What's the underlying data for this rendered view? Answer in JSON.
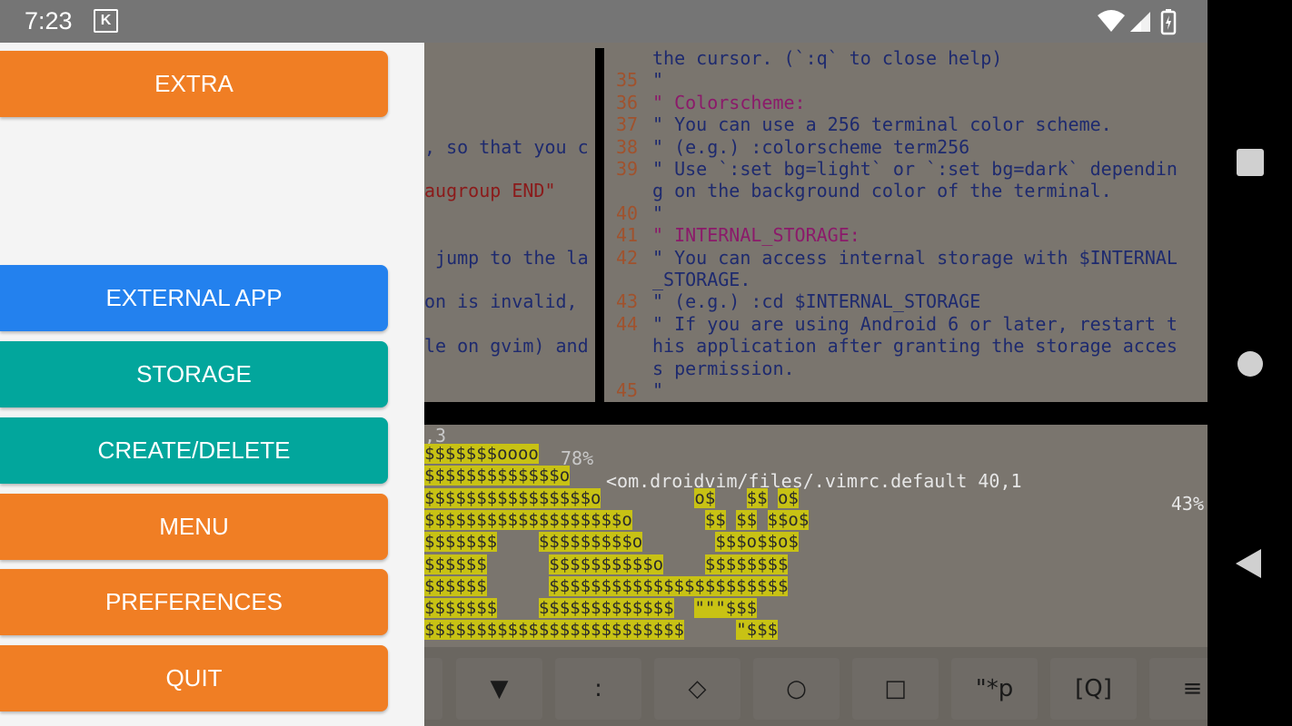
{
  "status_bar": {
    "time": "7:23",
    "app_icon_letter": "K",
    "icons": [
      "wifi-icon",
      "signal-icon",
      "battery-icon"
    ]
  },
  "drawer": {
    "buttons": [
      {
        "label": "EXTRA",
        "color": "#f07e24"
      },
      {
        "label": "EXTERNAL APP",
        "color": "#2381ee"
      },
      {
        "label": "STORAGE",
        "color": "#02a69c"
      },
      {
        "label": "CREATE/DELETE",
        "color": "#02a69c"
      },
      {
        "label": "MENU",
        "color": "#f07e24"
      },
      {
        "label": "PREFERENCES",
        "color": "#f07e24"
      },
      {
        "label": "QUIT",
        "color": "#f07e24"
      }
    ]
  },
  "vim": {
    "left_pane": [
      "",
      "",
      "",
      "",
      ", so that you c",
      "",
      "augroup END\"",
      "",
      "",
      " jump to the la",
      "",
      "on is invalid, ",
      "",
      "le on gvim) and",
      ""
    ],
    "right_pane": [
      {
        "num": "",
        "text": "the cursor. (`:q` to close help)"
      },
      {
        "num": "35",
        "text": "\""
      },
      {
        "num": "36",
        "text": "\" Colorscheme:"
      },
      {
        "num": "37",
        "text": "\" You can use a 256 terminal color scheme."
      },
      {
        "num": "38",
        "text": "\" (e.g.) :colorscheme term256"
      },
      {
        "num": "39",
        "text": "\" Use `:set bg=light` or `:set bg=dark` dependin"
      },
      {
        "num": "",
        "text": "g on the background color of the terminal."
      },
      {
        "num": "40",
        "text": "\""
      },
      {
        "num": "41",
        "text": "\" INTERNAL_STORAGE:"
      },
      {
        "num": "42",
        "text": "\" You can access internal storage with $INTERNAL"
      },
      {
        "num": "",
        "text": "_STORAGE."
      },
      {
        "num": "43",
        "text": "\" (e.g.) :cd $INTERNAL_STORAGE"
      },
      {
        "num": "44",
        "text": "\" If you are using Android 6 or later, restart t"
      },
      {
        "num": "",
        "text": "his application after granting the storage acces"
      },
      {
        "num": "",
        "text": "s permission."
      },
      {
        "num": "45",
        "text": "\""
      }
    ],
    "status_left": ",3",
    "status_left_pct": "78%",
    "status_file": "<om.droidvim/files/.vimrc.default 40,1",
    "status_right_pct": "43%",
    "art_lines": [
      "$$$$$$$oooo",
      "$$$$$$$$$$$$$o",
      "$$$$$$$$$$$$$$$$o         o$   $$ o$",
      "$$$$$$$$$$$$$$$$$$$o       $$ $$ $$o$",
      "$$$$$$$    $$$$$$$$$o       $$$o$$o$",
      "$$$$$$      $$$$$$$$$$o    $$$$$$$$",
      "$$$$$$      $$$$$$$$$$$$$$$$$$$$$$$",
      "$$$$$$$    $$$$$$$$$$$$$  \"\"\"$$$",
      "$$$$$$$$$$$$$$$$$$$$$$$$$     \"$$$"
    ]
  },
  "keybar": {
    "keys": [
      "",
      "▼",
      ":",
      "◇",
      "○",
      "□",
      "\"*p",
      "[Q]",
      "≡"
    ]
  },
  "navbar": {
    "buttons": [
      "recents-button",
      "home-button",
      "back-button"
    ]
  }
}
